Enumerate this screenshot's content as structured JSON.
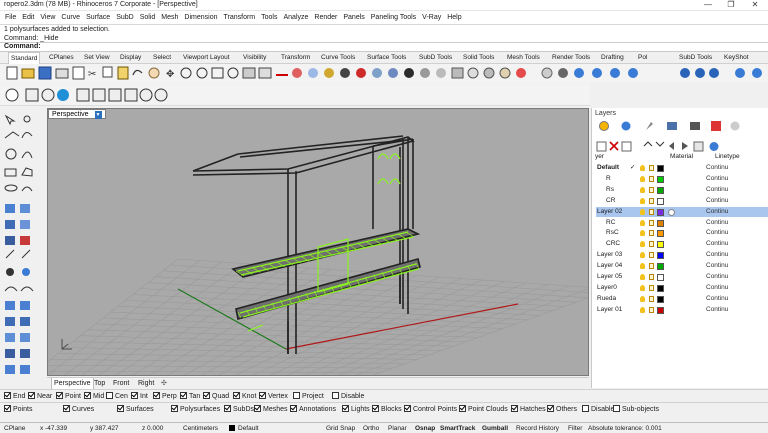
{
  "window": {
    "title": "ropero2.3dm (78 MB) - Rhinoceros 7 Corporate - [Perspective]",
    "controls": [
      "—",
      "❐",
      "✕"
    ]
  },
  "menu": [
    "File",
    "Edit",
    "View",
    "Curve",
    "Surface",
    "SubD",
    "Solid",
    "Mesh",
    "Dimension",
    "Transform",
    "Tools",
    "Analyze",
    "Render",
    "Panels",
    "Paneling Tools",
    "V-Ray",
    "Help"
  ],
  "command": {
    "history1": "1 polysurfaces added to selection.",
    "history2": "Command: _Hide",
    "prompt": "Command:"
  },
  "tabs": [
    "Standard",
    "CPlanes",
    "Set View",
    "Display",
    "Select",
    "Viewport Layout",
    "Visibility",
    "Transform",
    "Curve Tools",
    "Surface Tools",
    "SubD Tools",
    "Solid Tools",
    "Mesh Tools",
    "Render Tools",
    "Drafting",
    "Pol",
    "SubD Tools",
    "KeyShot"
  ],
  "viewport": {
    "name": "Perspective",
    "tabs": [
      "Perspective",
      "Top",
      "Front",
      "Right"
    ]
  },
  "layers": {
    "panel_title": "Layers",
    "col_name": "yer",
    "col_material": "Material",
    "col_linetype": "Linetype",
    "rows": [
      {
        "name": "Default",
        "indent": 0,
        "check": "✓",
        "color": "#000000",
        "linetype": "Continu",
        "bold": true
      },
      {
        "name": "R",
        "indent": 1,
        "check": "",
        "color": "#00cc00",
        "linetype": "Continu"
      },
      {
        "name": "Rs",
        "indent": 1,
        "check": "",
        "color": "#00aa00",
        "linetype": "Continu"
      },
      {
        "name": "CR",
        "indent": 1,
        "check": "",
        "color": "#ffffff",
        "linetype": "Continu"
      },
      {
        "name": "Layer 02",
        "indent": 0,
        "check": "",
        "color": "#7a2be2",
        "linetype": "Continu",
        "selected": true
      },
      {
        "name": "RC",
        "indent": 1,
        "check": "",
        "color": "#e08000",
        "linetype": "Continu"
      },
      {
        "name": "RsC",
        "indent": 1,
        "check": "",
        "color": "#ff9900",
        "linetype": "Continu"
      },
      {
        "name": "CRC",
        "indent": 1,
        "check": "",
        "color": "#ffff00",
        "linetype": "Continu"
      },
      {
        "name": "Layer 03",
        "indent": 0,
        "check": "",
        "color": "#0000ff",
        "linetype": "Continu"
      },
      {
        "name": "Layer 04",
        "indent": 0,
        "check": "",
        "color": "#00aa00",
        "linetype": "Continu"
      },
      {
        "name": "Layer 05",
        "indent": 0,
        "check": "",
        "color": "#ffffff",
        "linetype": "Continu"
      },
      {
        "name": "Layer0",
        "indent": 0,
        "check": "",
        "color": "#000000",
        "linetype": "Continu"
      },
      {
        "name": "Rueda",
        "indent": 0,
        "check": "",
        "color": "#000000",
        "linetype": "Continu"
      },
      {
        "name": "Layer 01",
        "indent": 0,
        "check": "",
        "color": "#cc0000",
        "linetype": "Continu"
      }
    ]
  },
  "osnap": [
    {
      "label": "End",
      "on": true
    },
    {
      "label": "Near",
      "on": true
    },
    {
      "label": "Point",
      "on": true
    },
    {
      "label": "Mid",
      "on": true
    },
    {
      "label": "Cen",
      "on": false
    },
    {
      "label": "Int",
      "on": true
    },
    {
      "label": "Perp",
      "on": true
    },
    {
      "label": "Tan",
      "on": true
    },
    {
      "label": "Quad",
      "on": true
    },
    {
      "label": "Knot",
      "on": true
    },
    {
      "label": "Vertex",
      "on": true
    },
    {
      "label": "Project",
      "on": false
    },
    {
      "label": "Disable",
      "on": false
    }
  ],
  "filters": [
    {
      "label": "Points",
      "on": true
    },
    {
      "label": "Curves",
      "on": true
    },
    {
      "label": "Surfaces",
      "on": true
    },
    {
      "label": "Polysurfaces",
      "on": true
    },
    {
      "label": "SubDs",
      "on": true
    },
    {
      "label": "Meshes",
      "on": true
    },
    {
      "label": "Annotations",
      "on": true
    },
    {
      "label": "Lights",
      "on": true
    },
    {
      "label": "Blocks",
      "on": true
    },
    {
      "label": "Control Points",
      "on": true
    },
    {
      "label": "Point Clouds",
      "on": true
    },
    {
      "label": "Hatches",
      "on": true
    },
    {
      "label": "Others",
      "on": true
    },
    {
      "label": "Disable",
      "on": false
    },
    {
      "label": "Sub-objects",
      "on": false
    }
  ],
  "status": {
    "cplane": "CPlane",
    "x": "x -47.339",
    "y": "y 387.427",
    "z": "z 0.000",
    "units": "Centimeters",
    "layer": "Default",
    "grid_snap": "Grid Snap",
    "ortho": "Ortho",
    "planar": "Planar",
    "osnap": "Osnap",
    "smarttrack": "SmartTrack",
    "gumball": "Gumball",
    "record_history": "Record History",
    "filter": "Filter",
    "tolerance": "Absolute tolerance: 0.001"
  }
}
